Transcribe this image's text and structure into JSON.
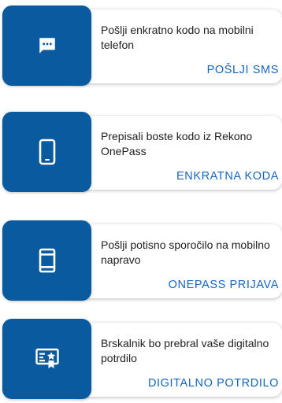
{
  "login_options": [
    {
      "icon": "sms-icon",
      "description": "Pošlji enkratno kodo na mobilni telefon",
      "action_label": "POŠLJI SMS"
    },
    {
      "icon": "smartphone-icon",
      "description": "Prepisali boste kodo iz Rekono OnePass",
      "action_label": "ENKRATNA KODA"
    },
    {
      "icon": "mobile-notification-icon",
      "description": "Pošlji potisno sporočilo na mobilno napravo",
      "action_label": "ONEPASS PRIJAVA"
    },
    {
      "icon": "certificate-icon",
      "description": "Brskalnik bo prebral vaše digitalno potrdilo",
      "action_label": "DIGITALNO POTRDILO"
    }
  ],
  "colors": {
    "tile_background": "#0a5aa0",
    "action_text": "#1565c0",
    "description_text": "#202124"
  }
}
